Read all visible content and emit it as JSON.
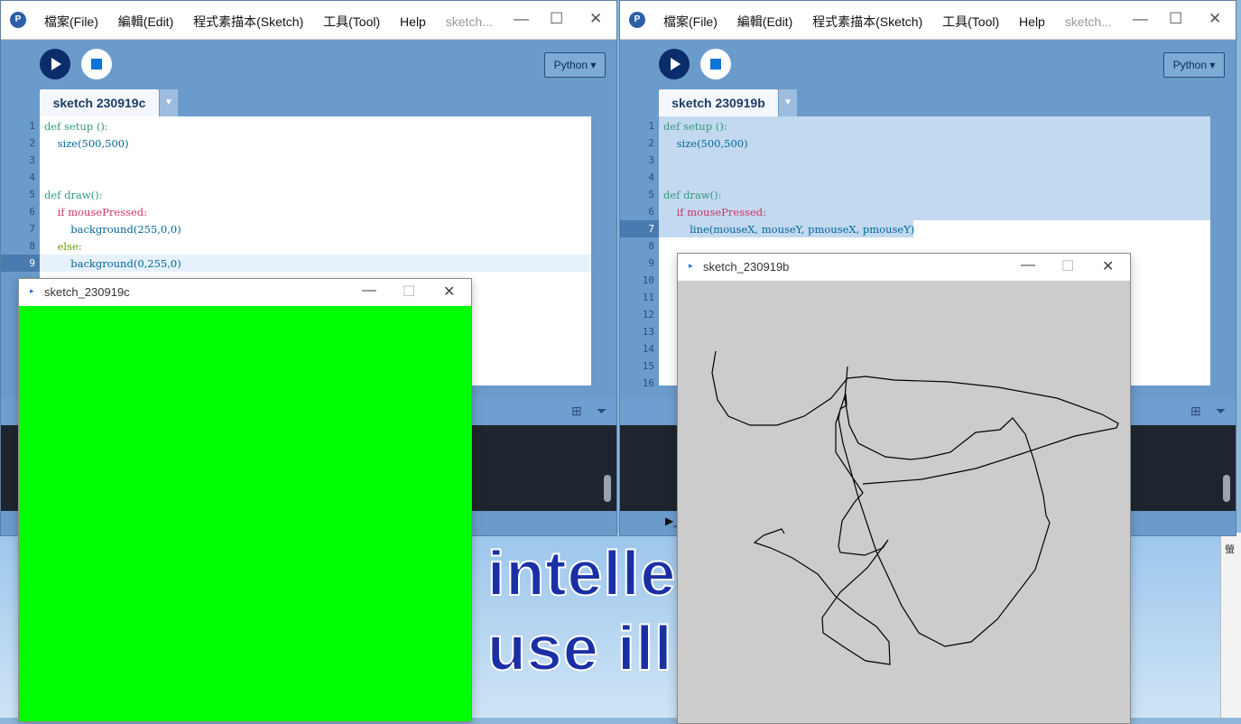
{
  "menu": [
    "檔案(File)",
    "編輯(Edit)",
    "程式素描本(Sketch)",
    "工具(Tool)",
    "Help"
  ],
  "window_a": {
    "title_faded": "sketch...",
    "mode": "Python ▾",
    "tab": "sketch 230919c",
    "line_numbers": [
      "1",
      "2",
      "3",
      "4",
      "5",
      "6",
      "7",
      "8",
      "9"
    ]
  },
  "window_b": {
    "title_faded": "sketch...",
    "mode": "Python ▾",
    "tab": "sketch 230919b",
    "line_numbers": [
      "1",
      "2",
      "3",
      "4",
      "5",
      "6",
      "7",
      "8",
      "9",
      "10",
      "11",
      "12",
      "13",
      "14",
      "15",
      "16"
    ]
  },
  "code_a": [
    "def setup ():",
    "    size(500,500)",
    "",
    "",
    "def draw():",
    "    if mousePressed:",
    "        background(255,0,0)",
    "    else:",
    "        background(0,255,0)"
  ],
  "code_b": [
    "def setup ():",
    "    size(500,500)",
    "",
    "",
    "def draw():",
    "    if mousePressed:",
    "        line(mouseX, mouseY, pmouseX, pmouseY)"
  ],
  "sketch_c": {
    "title": "sketch_230919c",
    "canvas_color": "#00ff00"
  },
  "sketch_b": {
    "title": "sketch_230919b",
    "canvas_color": "#cccccc"
  },
  "desktop": {
    "line1": "intelle         rig",
    "line2": "use ill         oro",
    "side_label": "螢"
  },
  "icons": {
    "minimize": "—",
    "maximize": "☐",
    "close": "✕"
  }
}
